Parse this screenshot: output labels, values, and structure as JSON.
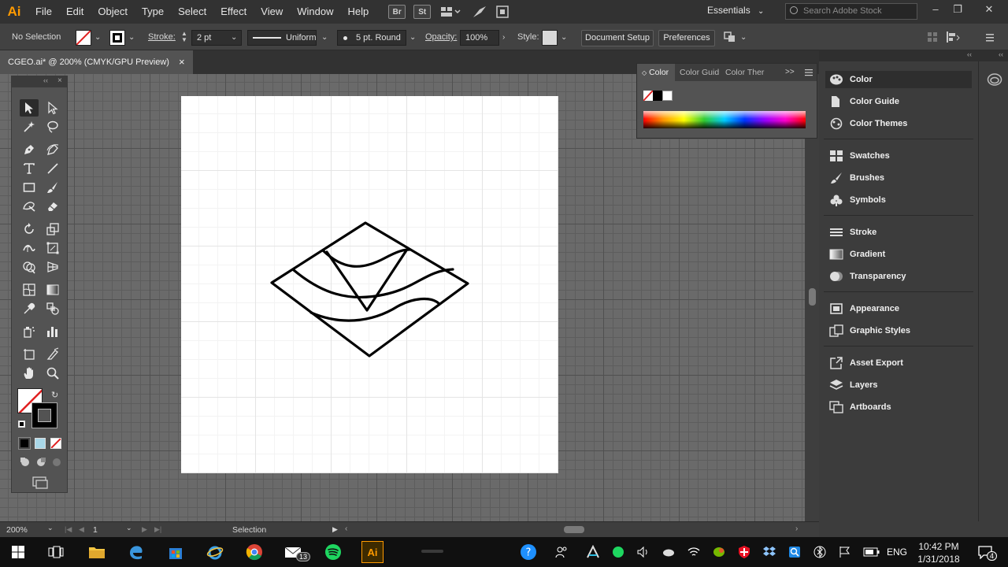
{
  "app": {
    "logo": "Ai",
    "menu": [
      "File",
      "Edit",
      "Object",
      "Type",
      "Select",
      "Effect",
      "View",
      "Window",
      "Help"
    ],
    "menu_icons": [
      "Br",
      "St"
    ],
    "workspace": "Essentials",
    "search_placeholder": "Search Adobe Stock"
  },
  "control": {
    "selection_status": "No Selection",
    "stroke_label": "Stroke:",
    "stroke_weight": "2 pt",
    "profile": "Uniform",
    "brush": "5 pt. Round",
    "opacity_label": "Opacity:",
    "opacity_value": "100%",
    "style_label": "Style:",
    "document_setup": "Document Setup",
    "preferences": "Preferences"
  },
  "document": {
    "tab_title": "CGEO.ai* @ 200% (CMYK/GPU Preview)",
    "close_glyph": "×"
  },
  "color_panel": {
    "tabs": [
      "Color",
      "Color Guid",
      "Color Ther"
    ],
    "more_glyph": ">>"
  },
  "dock": {
    "groups": [
      [
        {
          "label": "Color",
          "icon": "palette-icon",
          "active": true
        },
        {
          "label": "Color Guide",
          "icon": "color-guide-icon"
        },
        {
          "label": "Color Themes",
          "icon": "color-themes-icon"
        }
      ],
      [
        {
          "label": "Swatches",
          "icon": "swatches-icon"
        },
        {
          "label": "Brushes",
          "icon": "brush-icon"
        },
        {
          "label": "Symbols",
          "icon": "symbols-icon"
        }
      ],
      [
        {
          "label": "Stroke",
          "icon": "stroke-icon"
        },
        {
          "label": "Gradient",
          "icon": "gradient-icon"
        },
        {
          "label": "Transparency",
          "icon": "transparency-icon"
        }
      ],
      [
        {
          "label": "Appearance",
          "icon": "appearance-icon"
        },
        {
          "label": "Graphic Styles",
          "icon": "graphic-styles-icon"
        }
      ],
      [
        {
          "label": "Asset Export",
          "icon": "asset-export-icon"
        },
        {
          "label": "Layers",
          "icon": "layers-icon"
        },
        {
          "label": "Artboards",
          "icon": "artboards-icon"
        }
      ]
    ]
  },
  "status": {
    "zoom": "200%",
    "artboard_number": "1",
    "current_tool": "Selection"
  },
  "taskbar": {
    "mail_badge": "13",
    "language": "ENG",
    "time": "10:42 PM",
    "date": "1/31/2018",
    "notification_count": "4"
  },
  "colors": {
    "menubar": "#323232",
    "panel": "#535353",
    "dock": "#3c3c3c",
    "accent_logo": "#ff9a00",
    "artboard": "#ffffff"
  }
}
